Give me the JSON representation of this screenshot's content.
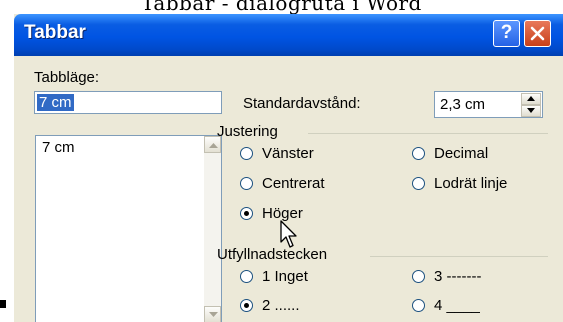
{
  "caption": "Tabbar - dialogruta i Word",
  "window": {
    "title": "Tabbar",
    "help_button": "?",
    "close_icon": "close-icon"
  },
  "tab_position": {
    "label": "Tabbläge:",
    "value": "7 cm",
    "list": [
      "7 cm"
    ]
  },
  "default_spacing": {
    "label": "Standardavstånd:",
    "value": "2,3 cm"
  },
  "alignment": {
    "title": "Justering",
    "options": [
      {
        "label": "Vänster",
        "selected": false
      },
      {
        "label": "Decimal",
        "selected": false
      },
      {
        "label": "Centrerat",
        "selected": false
      },
      {
        "label": "Lodrät linje",
        "selected": false
      },
      {
        "label": "Höger",
        "selected": true
      }
    ]
  },
  "leader": {
    "title": "Utfyllnadstecken",
    "options": [
      {
        "label": "1 Inget",
        "selected": false
      },
      {
        "label": "3 -------",
        "selected": false
      },
      {
        "label": "2 ......",
        "selected": true
      },
      {
        "label": "4 ____",
        "selected": false
      }
    ]
  },
  "colors": {
    "title_bar": "#0054e3",
    "dialog_bg": "#ece9d8",
    "selection": "#316ac5",
    "close_button": "#c8401a"
  }
}
